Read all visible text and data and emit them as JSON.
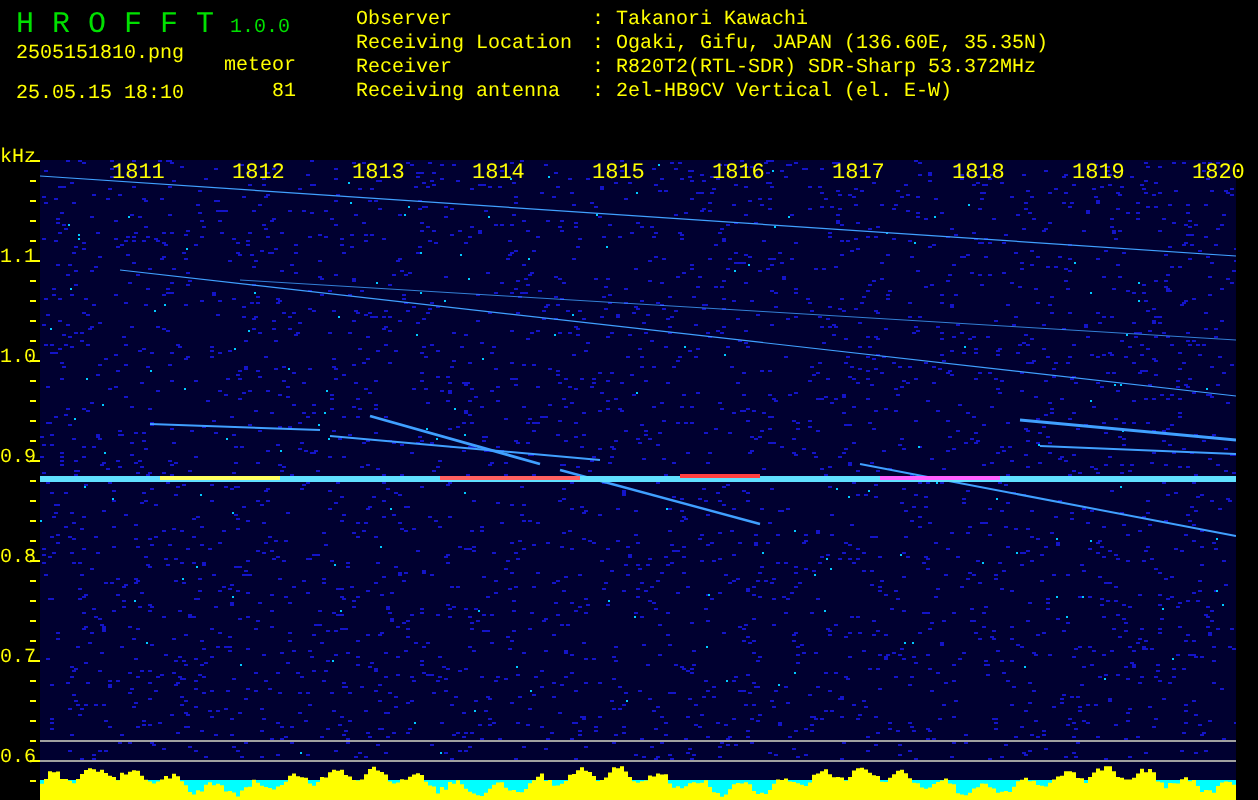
{
  "app": {
    "name": "H R O F F T",
    "version": "1.0.0"
  },
  "file_name": "2505151810.png",
  "timestamp": "25.05.15 18:10",
  "meteor": {
    "label": "meteor",
    "count": "81"
  },
  "station_info": [
    {
      "label": "Observer",
      "separator": ":",
      "value": "Takanori Kawachi"
    },
    {
      "label": "Receiving Location",
      "separator": ":",
      "value": "Ogaki, Gifu, JAPAN (136.60E, 35.35N)"
    },
    {
      "label": "Receiver",
      "separator": ":",
      "value": "R820T2(RTL-SDR) SDR-Sharp 53.372MHz"
    },
    {
      "label": "Receiving antenna",
      "separator": ":",
      "value": "2el-HB9CV Vertical (el. E-W)"
    }
  ],
  "spectrogram": {
    "unit": "kHz",
    "x_ticks": [
      "1811",
      "1812",
      "1813",
      "1814",
      "1815",
      "1816",
      "1817",
      "1818",
      "1819",
      "1820"
    ],
    "y_ticks": [
      "1.1",
      "1.0",
      "0.9",
      "0.8",
      "0.7",
      "0.6"
    ]
  }
}
